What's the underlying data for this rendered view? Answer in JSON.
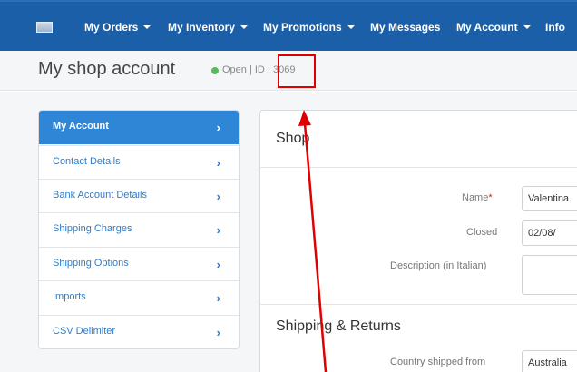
{
  "nav": {
    "items": [
      "My Orders",
      "My Inventory",
      "My Promotions",
      "My Messages",
      "My Account",
      "Info"
    ],
    "colors": {
      "bar": "#1b5fa8"
    }
  },
  "header": {
    "title": "My shop account",
    "status": "Open | ID : 3069"
  },
  "sidebar": {
    "items": [
      {
        "label": "My Account",
        "active": true
      },
      {
        "label": "Contact Details"
      },
      {
        "label": "Bank Account Details"
      },
      {
        "label": "Shipping Charges"
      },
      {
        "label": "Shipping Options"
      },
      {
        "label": "Imports"
      },
      {
        "label": "CSV Delimiter"
      }
    ],
    "chevron": "›"
  },
  "main": {
    "shop_title": "Shop",
    "name_label": "Name",
    "required_mark": "*",
    "name_value": "Valentina",
    "closed_label": "Closed",
    "closed_value": "02/08/",
    "description_label": "Description (in Italian)",
    "description_value": "",
    "shipping_title": "Shipping & Returns",
    "country_label": "Country shipped from",
    "country_value": "Australia"
  }
}
